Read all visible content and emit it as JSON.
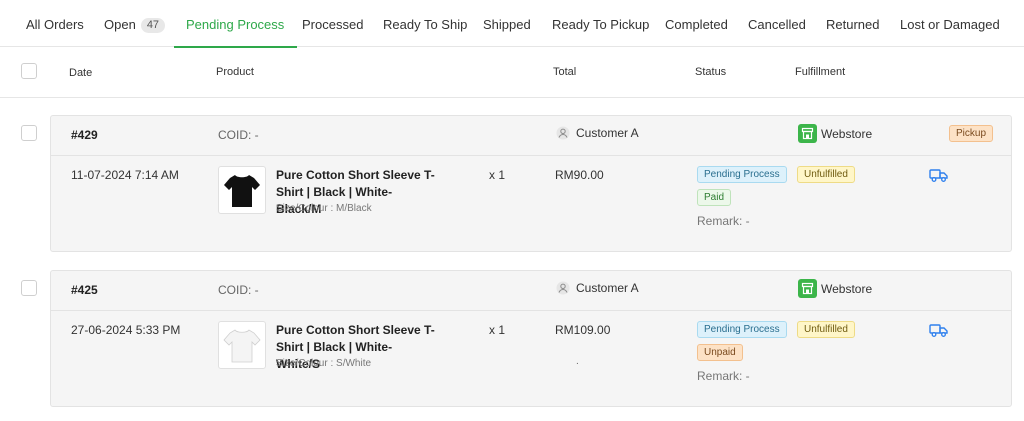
{
  "tabs": [
    {
      "label": "All Orders"
    },
    {
      "label": "Open",
      "count": "47"
    },
    {
      "label": "Pending Process",
      "active": true
    },
    {
      "label": "Processed"
    },
    {
      "label": "Ready To Ship"
    },
    {
      "label": "Shipped"
    },
    {
      "label": "Ready To Pickup"
    },
    {
      "label": "Completed"
    },
    {
      "label": "Cancelled"
    },
    {
      "label": "Returned"
    },
    {
      "label": "Lost or Damaged"
    }
  ],
  "columns": {
    "date": "Date",
    "product": "Product",
    "total": "Total",
    "status": "Status",
    "fulfillment": "Fulfillment"
  },
  "orders": [
    {
      "id": "#429",
      "coid": "COID: -",
      "customer": "Customer A",
      "channel": "Webstore",
      "delivery_tag": "Pickup",
      "date": "11-07-2024 7:14 AM",
      "product_name": "Pure Cotton Short Sleeve T-Shirt | Black | White-Black/M",
      "variant": "Size/Colour : M/Black",
      "quantity": "x 1",
      "total": "RM90.00",
      "total_note": "",
      "status": "Pending Process",
      "payment": "Paid",
      "remark": "Remark: -",
      "fulfillment": "Unfulfilled",
      "shirt_color": "#111111"
    },
    {
      "id": "#425",
      "coid": "COID: -",
      "customer": "Customer A",
      "channel": "Webstore",
      "delivery_tag": "",
      "date": "27-06-2024 5:33 PM",
      "product_name": "Pure Cotton Short Sleeve T-Shirt | Black | White-White/S",
      "variant": "Size/Colour : S/White",
      "quantity": "x 1",
      "total": "RM109.00",
      "total_note": ".",
      "status": "Pending Process",
      "payment": "Unpaid",
      "remark": "Remark: -",
      "fulfillment": "Unfulfilled",
      "shirt_color": "#f4f4f4"
    }
  ],
  "colors": {
    "accent": "#2ea84a",
    "store": "#3cb54a",
    "truck": "#2f80ed"
  },
  "icons": {
    "customer": "person-icon",
    "channel": "store-icon",
    "ship": "truck-icon"
  }
}
